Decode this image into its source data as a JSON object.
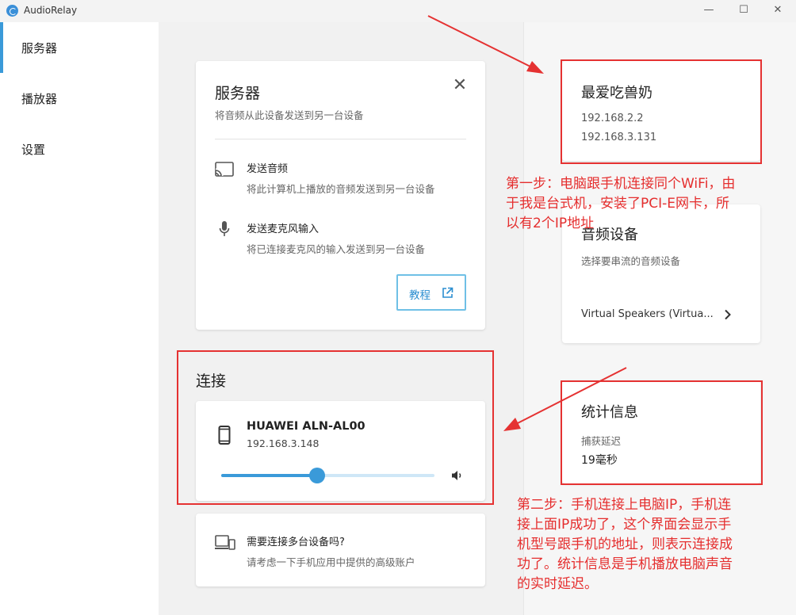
{
  "window": {
    "title": "AudioRelay",
    "controls": {
      "minimize": "—",
      "maximize": "☐",
      "close": "✕"
    }
  },
  "sidebar": {
    "items": [
      {
        "label": "服务器",
        "active": true
      },
      {
        "label": "播放器",
        "active": false
      },
      {
        "label": "设置",
        "active": false
      }
    ],
    "accent_color": "#3a9ad9"
  },
  "server_card": {
    "title": "服务器",
    "subtitle": "将音频从此设备发送到另一台设备",
    "options": [
      {
        "icon": "cast-icon",
        "title": "发送音频",
        "desc": "将此计算机上播放的音频发送到另一台设备"
      },
      {
        "icon": "microphone-icon",
        "title": "发送麦克风输入",
        "desc": "将已连接麦克风的输入发送到另一台设备"
      }
    ],
    "tutorial_label": "教程"
  },
  "connection": {
    "title": "连接",
    "device_name": "HUAWEI ALN-AL00",
    "device_ip": "192.168.3.148",
    "volume_fraction": 0.45
  },
  "multi_device": {
    "title": "需要连接多台设备吗?",
    "desc": "请考虑一下手机应用中提供的高级账户"
  },
  "host_card": {
    "title": "最爱吃兽奶",
    "ips": [
      "192.168.2.2",
      "192.168.3.131"
    ]
  },
  "audio_device_card": {
    "title": "音频设备",
    "subtitle": "选择要串流的音频设备",
    "selected": "Virtual Speakers (Virtua..."
  },
  "stats_card": {
    "title": "统计信息",
    "latency_label": "捕获延迟",
    "latency_value": "19毫秒"
  },
  "annotations": {
    "step1": [
      "第一步：电脑跟手机连接同个WiFi，由",
      "于我是台式机，安装了PCI-E网卡，所",
      "以有2个IP地址"
    ],
    "step2": [
      "第二步：手机连接上电脑IP，手机连",
      "接上面IP成功了，这个界面会显示手",
      "机型号跟手机的地址，则表示连接成",
      "功了。统计信息是手机播放电脑声音",
      "的实时延迟。"
    ],
    "color": "#e53232"
  }
}
